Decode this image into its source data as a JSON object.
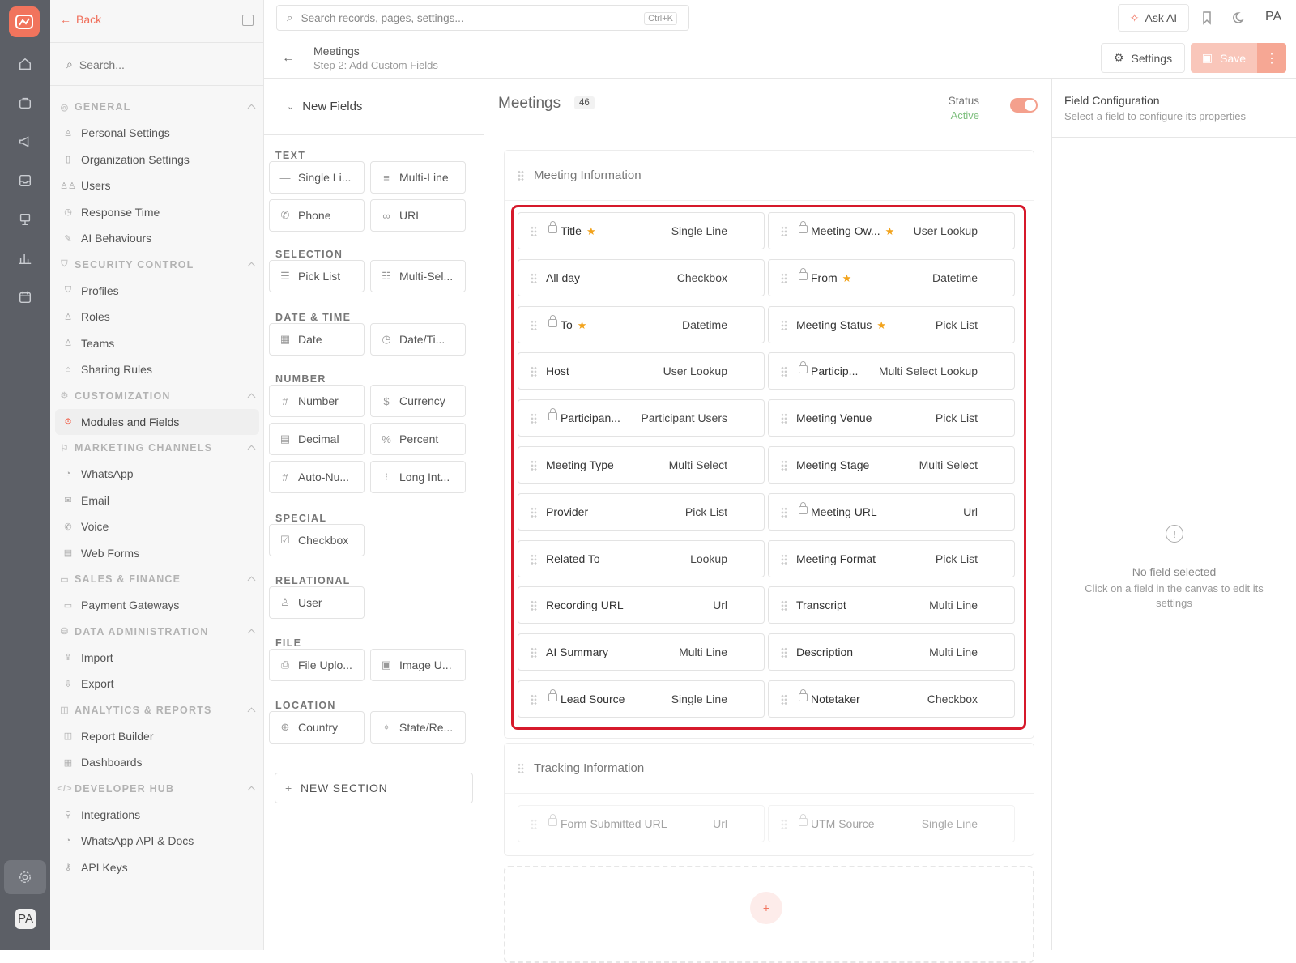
{
  "sidebar": {
    "back_label": "Back",
    "search_placeholder": "Search...",
    "sections": [
      {
        "title": "GENERAL",
        "items": [
          "Personal Settings",
          "Organization Settings",
          "Users",
          "Response Time",
          "AI Behaviours"
        ]
      },
      {
        "title": "SECURITY CONTROL",
        "items": [
          "Profiles",
          "Roles",
          "Teams",
          "Sharing Rules"
        ]
      },
      {
        "title": "CUSTOMIZATION",
        "items": [
          "Modules and Fields"
        ]
      },
      {
        "title": "MARKETING CHANNELS",
        "items": [
          "WhatsApp",
          "Email",
          "Voice",
          "Web Forms"
        ]
      },
      {
        "title": "SALES & FINANCE",
        "items": [
          "Payment Gateways"
        ]
      },
      {
        "title": "DATA ADMINISTRATION",
        "items": [
          "Import",
          "Export"
        ]
      },
      {
        "title": "ANALYTICS & REPORTS",
        "items": [
          "Report Builder",
          "Dashboards"
        ]
      },
      {
        "title": "DEVELOPER HUB",
        "items": [
          "Integrations",
          "WhatsApp API & Docs",
          "API Keys"
        ]
      }
    ],
    "selected_item": "Modules and Fields"
  },
  "rail": {
    "avatar_initials": "PA"
  },
  "topbar": {
    "search_placeholder": "Search records, pages, settings...",
    "search_shortcut": "Ctrl+K",
    "ask_ai_label": "Ask AI",
    "user_initials": "PA"
  },
  "subbar": {
    "title": "Meetings",
    "subtitle": "Step 2: Add Custom Fields",
    "settings_label": "Settings",
    "save_label": "Save"
  },
  "palette": {
    "header": "New Fields",
    "categories": [
      {
        "title": "TEXT",
        "items": [
          {
            "icon": "—",
            "label": "Single Li..."
          },
          {
            "icon": "≡",
            "label": "Multi-Line"
          },
          {
            "icon": "✆",
            "label": "Phone"
          },
          {
            "icon": "∞",
            "label": "URL"
          }
        ]
      },
      {
        "title": "SELECTION",
        "items": [
          {
            "icon": "☰",
            "label": "Pick List"
          },
          {
            "icon": "☷",
            "label": "Multi-Sel..."
          }
        ]
      },
      {
        "title": "DATE & TIME",
        "items": [
          {
            "icon": "▦",
            "label": "Date"
          },
          {
            "icon": "◷",
            "label": "Date/Ti..."
          }
        ]
      },
      {
        "title": "NUMBER",
        "items": [
          {
            "icon": "#",
            "label": "Number"
          },
          {
            "icon": "$",
            "label": "Currency"
          },
          {
            "icon": "▤",
            "label": "Decimal"
          },
          {
            "icon": "%",
            "label": "Percent"
          },
          {
            "icon": "#",
            "label": "Auto-Nu..."
          },
          {
            "icon": "⁝",
            "label": "Long Int..."
          }
        ]
      },
      {
        "title": "SPECIAL",
        "items": [
          {
            "icon": "☑",
            "label": "Checkbox"
          }
        ]
      },
      {
        "title": "RELATIONAL",
        "items": [
          {
            "icon": "♙",
            "label": "User"
          }
        ]
      },
      {
        "title": "FILE",
        "items": [
          {
            "icon": "⎙",
            "label": "File Uplo..."
          },
          {
            "icon": "▣",
            "label": "Image U..."
          }
        ]
      },
      {
        "title": "LOCATION",
        "items": [
          {
            "icon": "⊕",
            "label": "Country"
          },
          {
            "icon": "⌖",
            "label": "State/Re..."
          }
        ]
      }
    ],
    "new_section_label": "NEW SECTION"
  },
  "canvas": {
    "module_title": "Meetings",
    "count": "46",
    "status_label": "Status",
    "status_value": "Active",
    "status_on": true,
    "sections": [
      {
        "title": "Meeting Information",
        "fields": [
          {
            "name": "Title",
            "type": "Single Line",
            "locked": true,
            "required": true
          },
          {
            "name": "Meeting Ow...",
            "type": "User Lookup",
            "locked": true,
            "required": true
          },
          {
            "name": "All day",
            "type": "Checkbox",
            "locked": false,
            "required": false
          },
          {
            "name": "From",
            "type": "Datetime",
            "locked": true,
            "required": true
          },
          {
            "name": "To",
            "type": "Datetime",
            "locked": true,
            "required": true
          },
          {
            "name": "Meeting Status",
            "type": "Pick List",
            "locked": false,
            "required": true
          },
          {
            "name": "Host",
            "type": "User Lookup",
            "locked": false,
            "required": false
          },
          {
            "name": "Particip...",
            "type": "Multi Select Lookup",
            "locked": true,
            "required": false
          },
          {
            "name": "Participan...",
            "type": "Participant Users",
            "locked": true,
            "required": false
          },
          {
            "name": "Meeting Venue",
            "type": "Pick List",
            "locked": false,
            "required": false
          },
          {
            "name": "Meeting Type",
            "type": "Multi Select",
            "locked": false,
            "required": false
          },
          {
            "name": "Meeting Stage",
            "type": "Multi Select",
            "locked": false,
            "required": false
          },
          {
            "name": "Provider",
            "type": "Pick List",
            "locked": false,
            "required": false
          },
          {
            "name": "Meeting URL",
            "type": "Url",
            "locked": true,
            "required": false
          },
          {
            "name": "Related To",
            "type": "Lookup",
            "locked": false,
            "required": false
          },
          {
            "name": "Meeting Format",
            "type": "Pick List",
            "locked": false,
            "required": false
          },
          {
            "name": "Recording URL",
            "type": "Url",
            "locked": false,
            "required": false
          },
          {
            "name": "Transcript",
            "type": "Multi Line",
            "locked": false,
            "required": false
          },
          {
            "name": "AI Summary",
            "type": "Multi Line",
            "locked": false,
            "required": false
          },
          {
            "name": "Description",
            "type": "Multi Line",
            "locked": false,
            "required": false
          },
          {
            "name": "Lead Source",
            "type": "Single Line",
            "locked": true,
            "required": false
          },
          {
            "name": "Notetaker",
            "type": "Checkbox",
            "locked": true,
            "required": false
          }
        ]
      },
      {
        "title": "Tracking Information",
        "fields": [
          {
            "name": "Form Submitted URL",
            "type": "Url",
            "locked": true,
            "required": false
          },
          {
            "name": "UTM Source",
            "type": "Single Line",
            "locked": true,
            "required": false
          }
        ]
      }
    ]
  },
  "config_panel": {
    "title": "Field Configuration",
    "subtitle": "Select a field to configure its properties",
    "empty_title": "No field selected",
    "empty_desc": "Click on a field in the canvas to edit its settings"
  },
  "colors": {
    "accent": "#f0705c",
    "highlight_border": "#d6192b",
    "required_star": "#f2a31c",
    "active_status": "#7ebf7e"
  }
}
